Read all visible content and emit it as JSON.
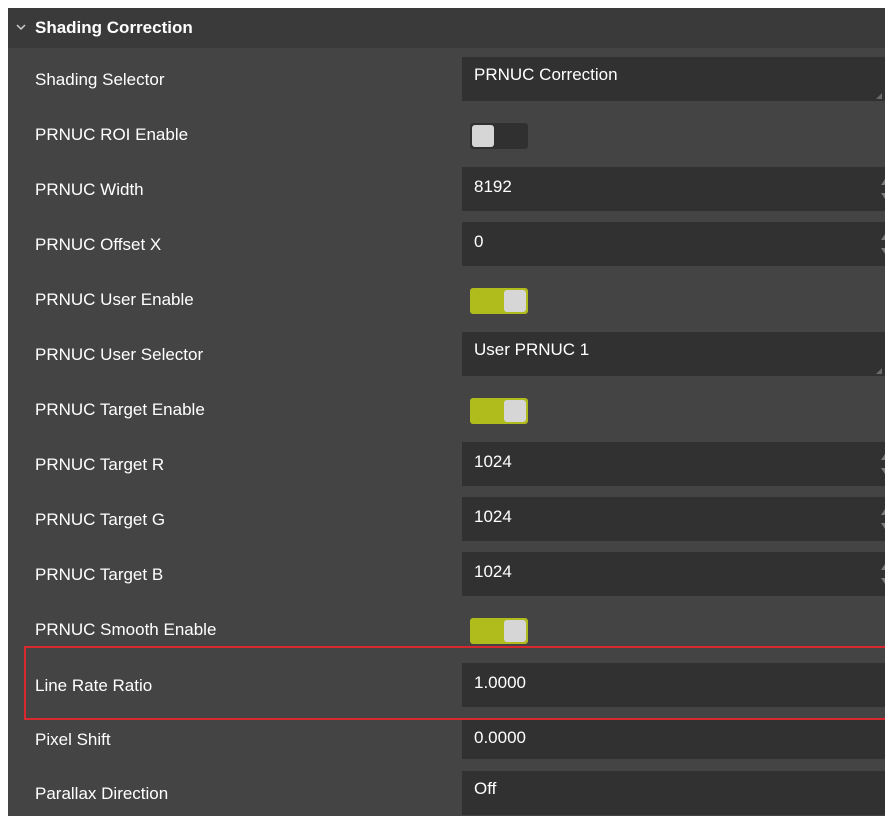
{
  "section": {
    "title": "Shading Correction",
    "chevron_icon": "chevron-down-icon"
  },
  "colors": {
    "panel_bg": "#444444",
    "field_bg": "#313131",
    "toggle_on": "#b0bb1c",
    "highlight_border": "#d8282d"
  },
  "rows": [
    {
      "label": "Shading Selector",
      "type": "combo",
      "value": "PRNUC Correction"
    },
    {
      "label": "PRNUC ROI Enable",
      "type": "toggle",
      "state": "off"
    },
    {
      "label": "PRNUC Width",
      "type": "spin",
      "value": "8192"
    },
    {
      "label": "PRNUC Offset X",
      "type": "spin",
      "value": "0"
    },
    {
      "label": "PRNUC User Enable",
      "type": "toggle",
      "state": "on"
    },
    {
      "label": "PRNUC User Selector",
      "type": "combo",
      "value": "User PRNUC 1"
    },
    {
      "label": "PRNUC Target Enable",
      "type": "toggle",
      "state": "on"
    },
    {
      "label": "PRNUC Target R",
      "type": "spin",
      "value": "1024"
    },
    {
      "label": "PRNUC Target G",
      "type": "spin",
      "value": "1024"
    },
    {
      "label": "PRNUC Target B",
      "type": "spin",
      "value": "1024"
    },
    {
      "label": "PRNUC Smooth Enable",
      "type": "toggle",
      "state": "on"
    },
    {
      "label": "Line Rate Ratio",
      "type": "text",
      "value": "1.0000",
      "highlighted": true
    },
    {
      "label": "Pixel Shift",
      "type": "text",
      "value": "0.0000"
    },
    {
      "label": "Parallax Direction",
      "type": "combo",
      "value": "Off"
    }
  ]
}
